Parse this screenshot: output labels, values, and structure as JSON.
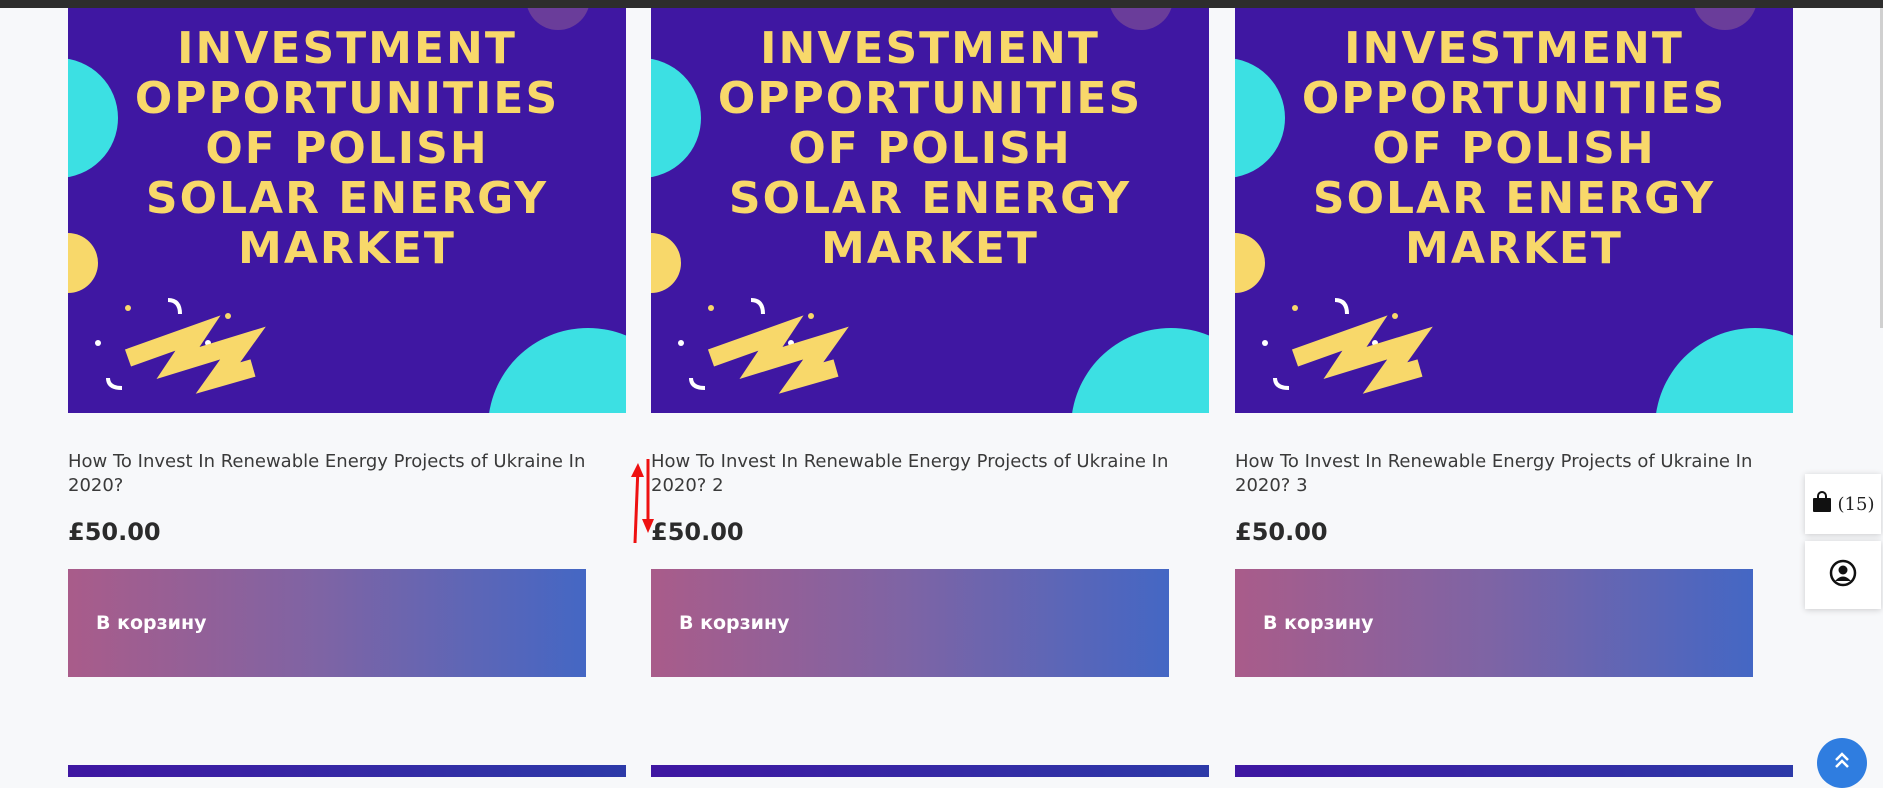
{
  "colors": {
    "banner_bg": "#3f17a2",
    "banner_text": "#f8d86a",
    "accent_cyan": "#3ce0e3",
    "button_gradient_start": "#a95c8a",
    "button_gradient_end": "#4467c4",
    "scroll_top_bg": "#2f7de0"
  },
  "products": [
    {
      "banner_text": "INVESTMENT\nOPPORTUNITIES\nOF POLISH\nSOLAR ENERGY\nMARKET",
      "title": "How To Invest In Renewable Energy Projects of Ukraine In 2020?",
      "price": "£50.00",
      "button_label": "В корзину"
    },
    {
      "banner_text": "INVESTMENT\nOPPORTUNITIES\nOF POLISH\nSOLAR ENERGY\nMARKET",
      "title": "How To Invest In Renewable Energy Projects of Ukraine In 2020? 2",
      "price": "£50.00",
      "button_label": "В корзину"
    },
    {
      "banner_text": "INVESTMENT\nOPPORTUNITIES\nOF POLISH\nSOLAR ENERGY\nMARKET",
      "title": "How To Invest In Renewable Energy Projects of Ukraine In 2020? 3",
      "price": "£50.00",
      "button_label": "В корзину"
    }
  ],
  "side_widgets": {
    "cart_icon": "shopping-bag-icon",
    "cart_count": "(15)",
    "account_icon": "user-circle-icon"
  },
  "scroll_top_icon": "double-chevron-up-icon",
  "annotation_icon": "red-up-down-arrows-icon"
}
